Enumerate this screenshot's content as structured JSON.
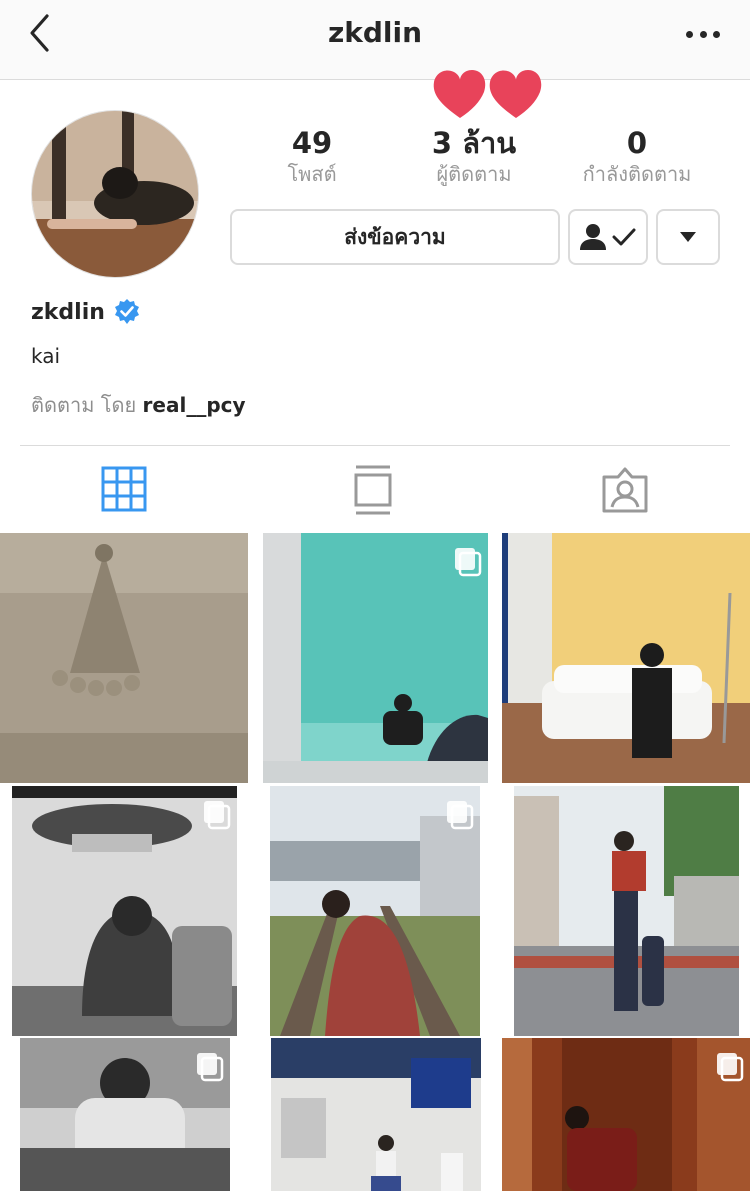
{
  "header": {
    "title": "zkdlin",
    "back_icon": "chevron-left-icon",
    "more_icon": "more-horizontal-icon"
  },
  "profile": {
    "stats": {
      "posts_count": "49",
      "posts_label": "โพสต์",
      "followers_count": "3 ล้าน",
      "followers_label": "ผู้ติดตาม",
      "following_count": "0",
      "following_label": "กำลังติดตาม"
    },
    "buttons": {
      "message_label": "ส่งข้อความ",
      "following_icon": "person-check-icon",
      "dropdown_icon": "caret-down-icon"
    },
    "username": "zkdlin",
    "verified_icon": "verified-badge-icon",
    "bio": "kai",
    "followed_by_prefix": "ติดตาม โดย",
    "followed_by_user": "real__pcy"
  },
  "tabs": [
    {
      "icon": "grid-icon",
      "active": true
    },
    {
      "icon": "feed-icon",
      "active": false
    },
    {
      "icon": "tagged-icon",
      "active": false
    }
  ],
  "colors": {
    "active_tab": "#3897f0",
    "inactive_tab": "#999999",
    "verified": "#3897f0",
    "heart": "#e8435a"
  }
}
